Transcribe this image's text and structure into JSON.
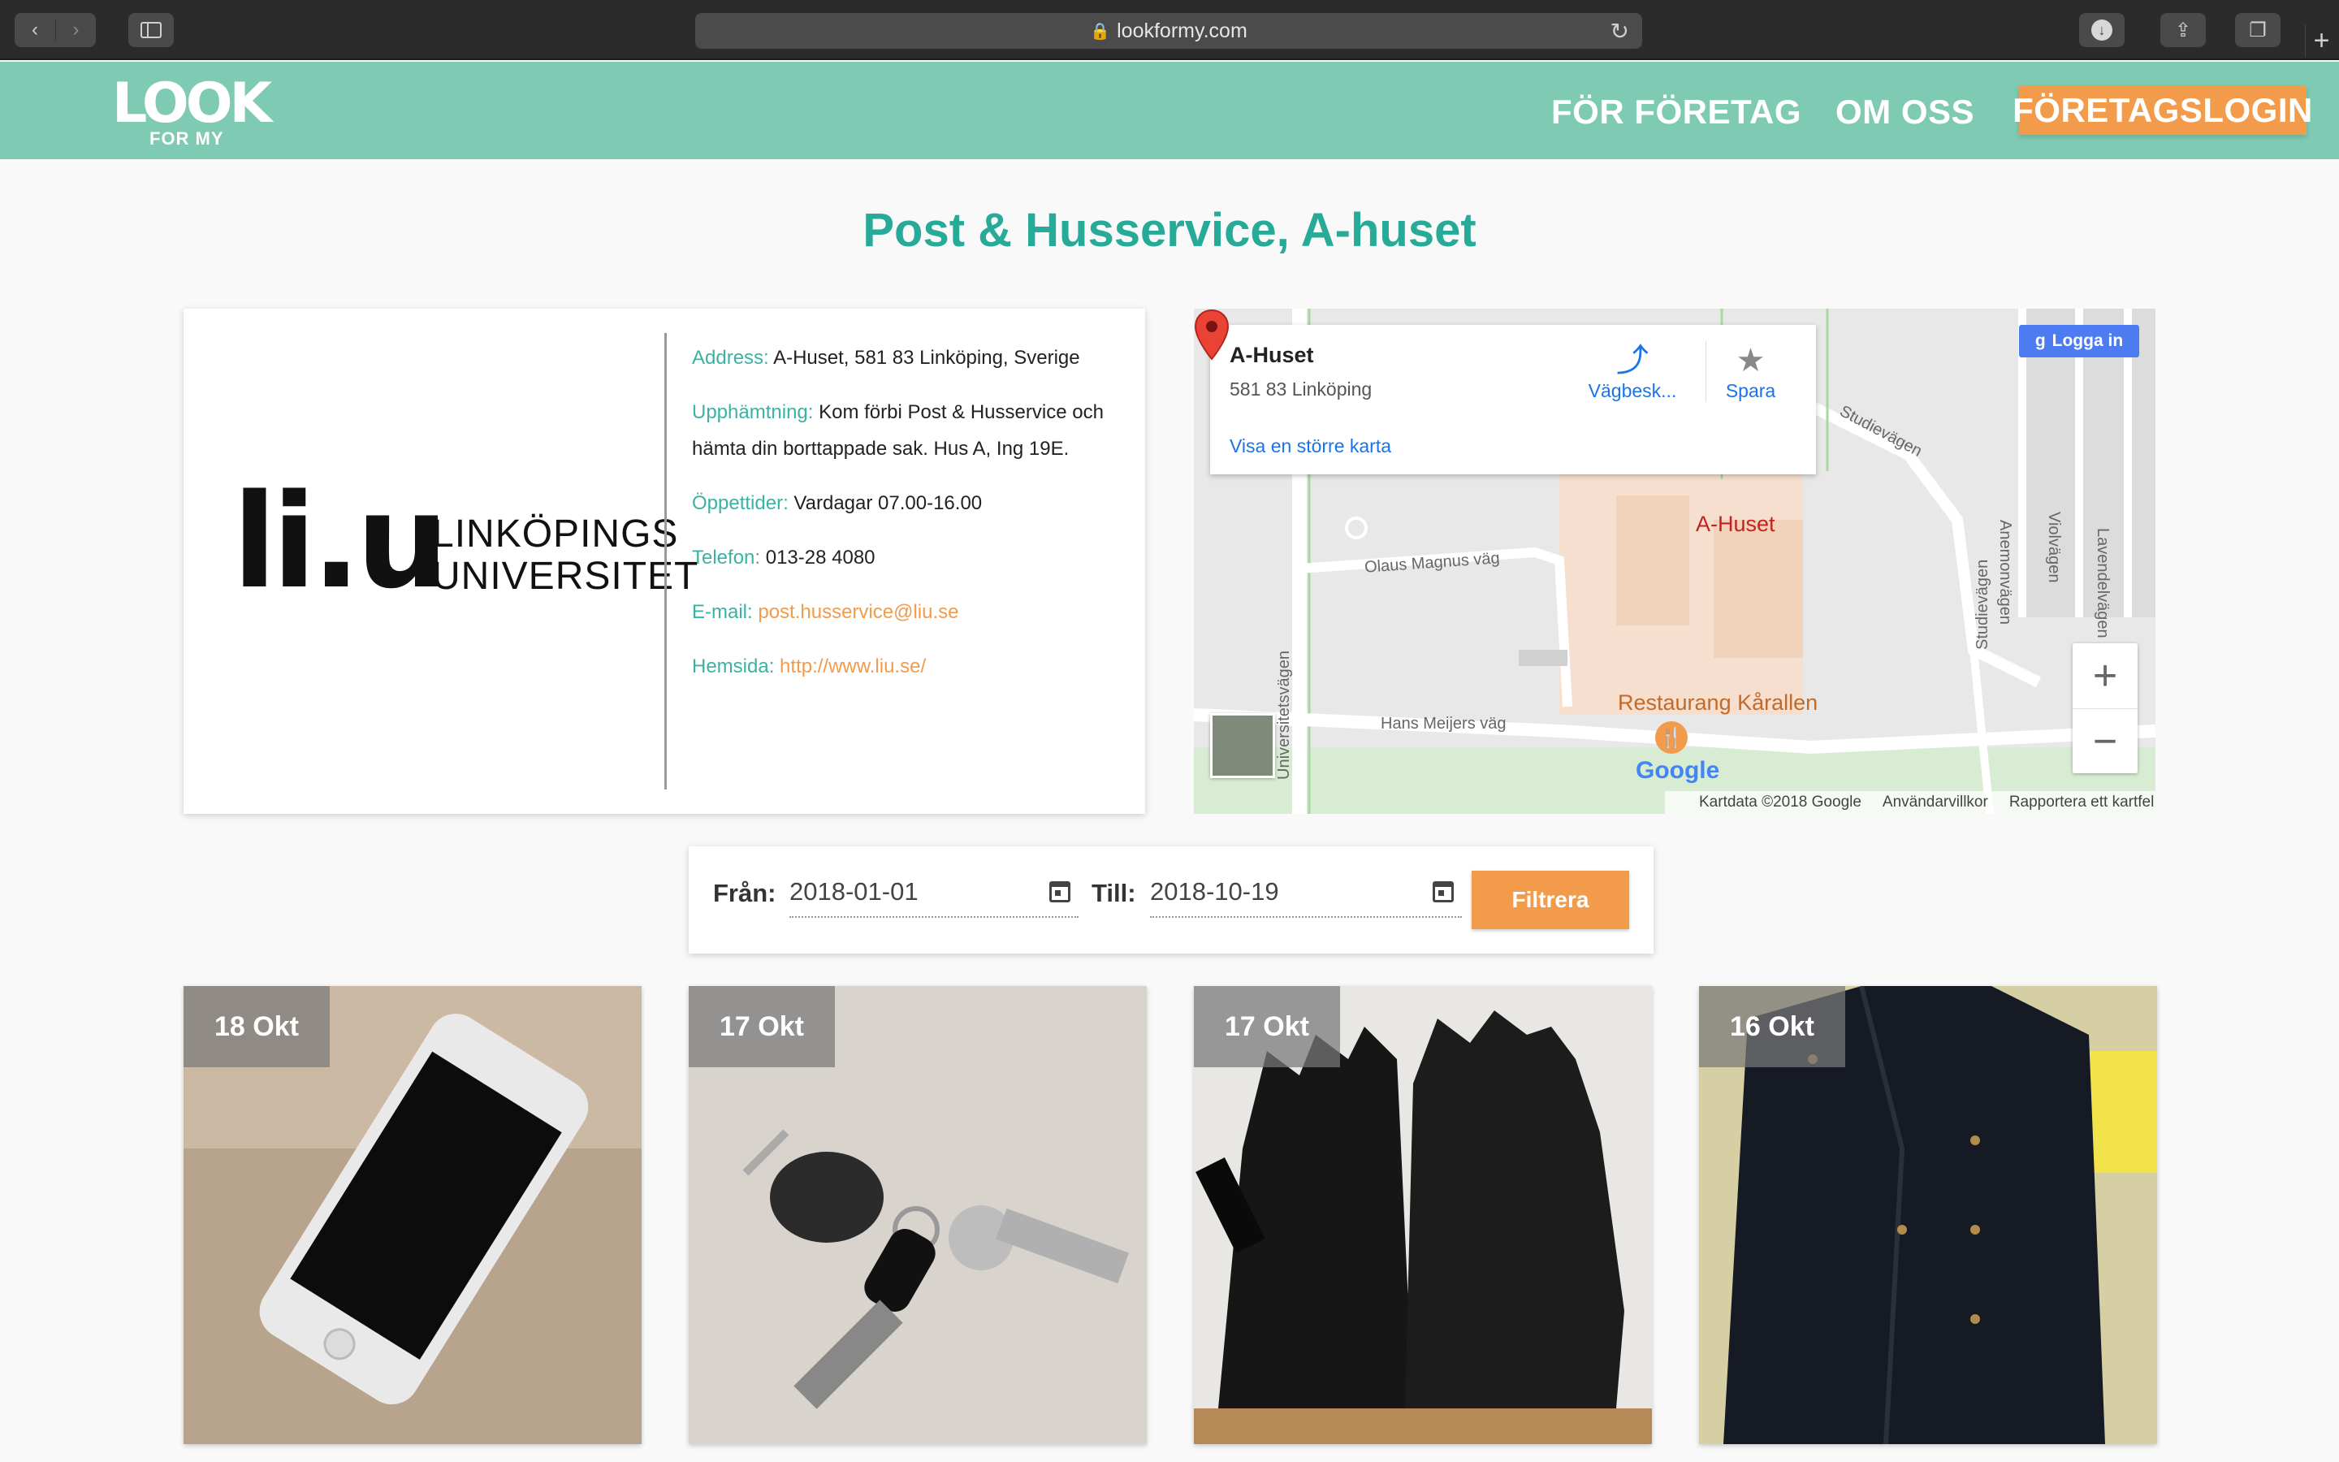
{
  "browser": {
    "url": "lookformy.com"
  },
  "header": {
    "logo_top": "LOOK",
    "logo_bottom": "FOR MY",
    "nav_company": "FÖR FÖRETAG",
    "nav_about": "OM OSS",
    "nav_login": "FÖRETAGSLOGIN"
  },
  "page_title": "Post & Husservice, A-huset",
  "org": {
    "logo_mark": "li.u",
    "logo_line1": "LINKÖPINGS",
    "logo_line2": "UNIVERSITET"
  },
  "info": {
    "address_label": "Address:",
    "address_value": "A-Huset, 581 83 Linköping, Sverige",
    "pickup_label": "Upphämtning:",
    "pickup_value": "Kom förbi Post & Husservice och hämta din borttappade sak. Hus A, Ing 19E.",
    "hours_label": "Öppettider:",
    "hours_value": "Vardagar 07.00-16.00",
    "phone_label": "Telefon:",
    "phone_value": "013-28 4080",
    "email_label": "E-mail:",
    "email_value": "post.husservice@liu.se",
    "web_label": "Hemsida:",
    "web_value": "http://www.liu.se/"
  },
  "map": {
    "place_name": "A-Huset",
    "place_address": "581 83 Linköping",
    "directions_label": "Vägbesk...",
    "save_label": "Spara",
    "bigger_map": "Visa en större karta",
    "google_login": "Logga in",
    "pin_label": "A-Huset",
    "restaurant_label": "Restaurang Kårallen",
    "streets": {
      "olaus": "Olaus Magnus väg",
      "hans": "Hans Meijers väg",
      "universitet": "Universitetsvägen",
      "studie": "Studievägen",
      "studie2": "Studievägen",
      "anemon": "Anemonvägen",
      "viol": "Violvägen",
      "lavendel": "Lavendelvägen"
    },
    "google": "Google",
    "footer_data": "Kartdata ©2018 Google",
    "footer_terms": "Användarvillkor",
    "footer_report": "Rapportera ett kartfel",
    "zoom_in": "+",
    "zoom_out": "−"
  },
  "filter": {
    "from_label": "Från:",
    "from_value": "2018-01-01",
    "to_label": "Till:",
    "to_value": "2018-10-19",
    "button": "Filtrera"
  },
  "items": [
    {
      "date": "18 Okt"
    },
    {
      "date": "17 Okt"
    },
    {
      "date": "17 Okt"
    },
    {
      "date": "16 Okt"
    }
  ]
}
